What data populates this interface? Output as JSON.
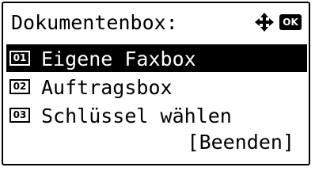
{
  "screen": {
    "title": "Dokumentenbox:",
    "ok_label": "OK",
    "nav_icon": "four-way-arrow-icon"
  },
  "menu": {
    "items": [
      {
        "number": "01",
        "label": "Eigene Faxbox",
        "selected": true
      },
      {
        "number": "02",
        "label": "Auftragsbox",
        "selected": false
      },
      {
        "number": "03",
        "label": "Schlüssel wählen",
        "selected": false
      }
    ]
  },
  "footer": {
    "exit_label": "[Beenden]"
  },
  "colors": {
    "background": "#ffffff",
    "foreground": "#000000",
    "highlight": "#000000"
  }
}
